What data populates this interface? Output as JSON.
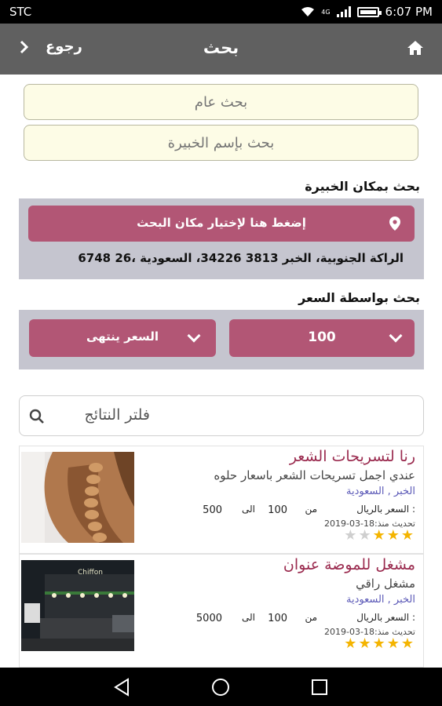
{
  "status": {
    "carrier": "STC",
    "network": "4G",
    "time": "6:07 PM"
  },
  "header": {
    "title": "بحث",
    "back_label": "رجوع"
  },
  "search": {
    "general_placeholder": "بحث عام",
    "expert_placeholder": "بحث بإسم الخبيرة"
  },
  "location": {
    "section_label": "بحث بمكان الخبيرة",
    "pick_button": "إضغط هنا لإختيار مكان البحث",
    "address": "الراكة الجنوبية، الخبر 3813 34226، السعودية ،26 6748"
  },
  "price": {
    "section_label": "بحث بواسطة السعر",
    "min_value": "100",
    "max_value": "السعر ينتهى"
  },
  "filter": {
    "placeholder": "فلتر النتائج"
  },
  "results": [
    {
      "name": "رنا لتسريحات الشعر",
      "desc": "عندي اجمل تسريحات الشعر باسعار حلوه",
      "city": "الخبر , السعودية",
      "price_label": "السعر بالريال :",
      "from_label": "من",
      "from_value": "100",
      "to_label": "الى",
      "to_value": "500",
      "updated": "تحديث منذ:18-03-2019",
      "rating": 3,
      "max_rating": 5,
      "thumb_icon": "braided-hair-photo"
    },
    {
      "name": "مشغل للموضة عنوان",
      "desc": "مشغل راقي",
      "city": "الخبر , السعودية",
      "price_label": "السعر بالريال :",
      "from_label": "من",
      "from_value": "100",
      "to_label": "الى",
      "to_value": "5000",
      "updated": "تحديث منذ:18-03-2019",
      "rating": 5,
      "max_rating": 5,
      "thumb_icon": "salon-storefront-night-photo",
      "thumb_sign": "Chiffon"
    }
  ],
  "colors": {
    "appbar": "#606060",
    "accent_pink": "#b25675",
    "input_bg": "#fdfce6",
    "panel_grey": "#c5c5cf",
    "name_color": "#9a2a4e",
    "city_color": "#5b59b7",
    "star": "#f4b400"
  }
}
